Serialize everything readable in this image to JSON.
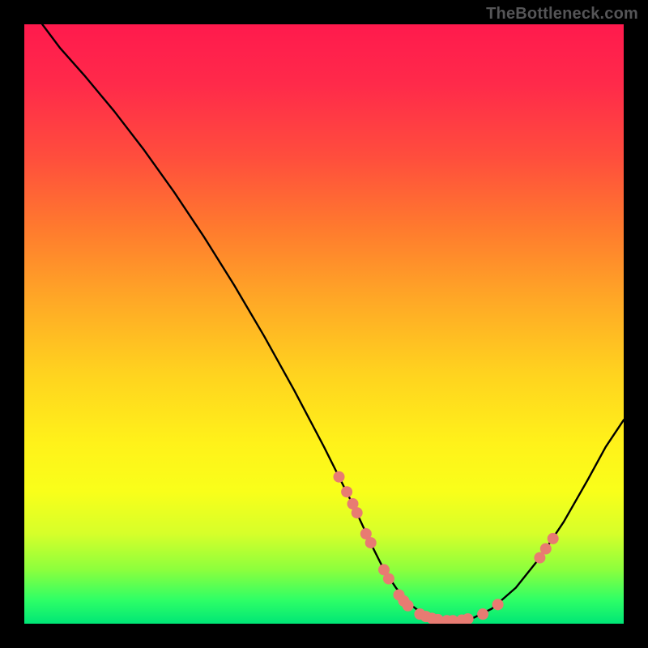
{
  "watermark": "TheBottleneck.com",
  "chart_data": {
    "type": "line",
    "title": "",
    "xlabel": "",
    "ylabel": "",
    "xlim": [
      0,
      100
    ],
    "ylim": [
      0,
      100
    ],
    "series": [
      {
        "name": "curve",
        "x": [
          3,
          6,
          10,
          15,
          20,
          25,
          30,
          35,
          40,
          45,
          50,
          55,
          58,
          60,
          62,
          64,
          66,
          68,
          70,
          72,
          75,
          78,
          82,
          86,
          90,
          94,
          97,
          100
        ],
        "y": [
          100,
          96,
          91.5,
          85.5,
          79,
          72,
          64.5,
          56.5,
          48,
          39,
          29.5,
          19.5,
          13,
          9,
          6,
          3.5,
          2,
          1,
          0.5,
          0.5,
          1,
          2.5,
          6,
          11,
          17,
          24,
          29.5,
          34
        ]
      }
    ],
    "markers": [
      {
        "x": 52.5,
        "y": 24.5
      },
      {
        "x": 53.8,
        "y": 22.0
      },
      {
        "x": 54.8,
        "y": 20.0
      },
      {
        "x": 55.5,
        "y": 18.5
      },
      {
        "x": 57.0,
        "y": 15.0
      },
      {
        "x": 57.8,
        "y": 13.5
      },
      {
        "x": 60.0,
        "y": 9.0
      },
      {
        "x": 60.8,
        "y": 7.5
      },
      {
        "x": 62.5,
        "y": 4.8
      },
      {
        "x": 63.3,
        "y": 3.8
      },
      {
        "x": 64.0,
        "y": 3.0
      },
      {
        "x": 66.0,
        "y": 1.6
      },
      {
        "x": 67.0,
        "y": 1.2
      },
      {
        "x": 68.0,
        "y": 0.9
      },
      {
        "x": 69.0,
        "y": 0.7
      },
      {
        "x": 70.5,
        "y": 0.5
      },
      {
        "x": 71.5,
        "y": 0.5
      },
      {
        "x": 73.0,
        "y": 0.6
      },
      {
        "x": 74.0,
        "y": 0.8
      },
      {
        "x": 76.5,
        "y": 1.6
      },
      {
        "x": 79.0,
        "y": 3.2
      },
      {
        "x": 86.0,
        "y": 11.0
      },
      {
        "x": 87.0,
        "y": 12.5
      },
      {
        "x": 88.2,
        "y": 14.2
      }
    ],
    "colors": {
      "curve": "#000000",
      "marker_fill": "#e87b72",
      "marker_stroke": "#b84f47"
    },
    "gradient_stops": [
      {
        "pos": 0,
        "color": "#ff1a4d"
      },
      {
        "pos": 100,
        "color": "#00e676"
      }
    ]
  }
}
